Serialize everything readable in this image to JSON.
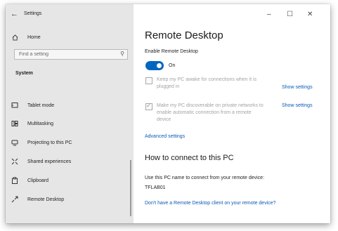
{
  "window": {
    "title": "Settings",
    "controls": {
      "minimize": "–",
      "maximize": "☐",
      "close": "✕"
    }
  },
  "sidebar": {
    "home_label": "Home",
    "search_placeholder": "Find a setting",
    "section_label": "System",
    "items": [
      {
        "label": "Tablet mode",
        "icon": "tablet-icon"
      },
      {
        "label": "Multitasking",
        "icon": "multitasking-icon"
      },
      {
        "label": "Projecting to this PC",
        "icon": "projecting-icon"
      },
      {
        "label": "Shared experiences",
        "icon": "shared-experiences-icon"
      },
      {
        "label": "Clipboard",
        "icon": "clipboard-icon"
      },
      {
        "label": "Remote Desktop",
        "icon": "remote-desktop-icon"
      }
    ]
  },
  "main": {
    "title": "Remote Desktop",
    "enable_label": "Enable Remote Desktop",
    "toggle_state": "On",
    "toggle_on": true,
    "accent_color": "#0067c0",
    "keep_awake": {
      "text_line1": "Keep my PC awake for connections when it is",
      "text_line2": "plugged in",
      "checked": false,
      "link": "Show settings"
    },
    "discoverable": {
      "text_line1": "Make my PC discoverable on private networks to",
      "text_line2": "enable automatic connection from a remote",
      "text_line3": "device",
      "checked": true,
      "link": "Show settings"
    },
    "advanced_link": "Advanced settings",
    "connect_heading": "How to connect to this PC",
    "connect_instructions": "Use this PC name to connect from your remote device:",
    "pc_name": "TFLAB01",
    "client_link": "Don't have a Remote Desktop client on your remote device?"
  }
}
